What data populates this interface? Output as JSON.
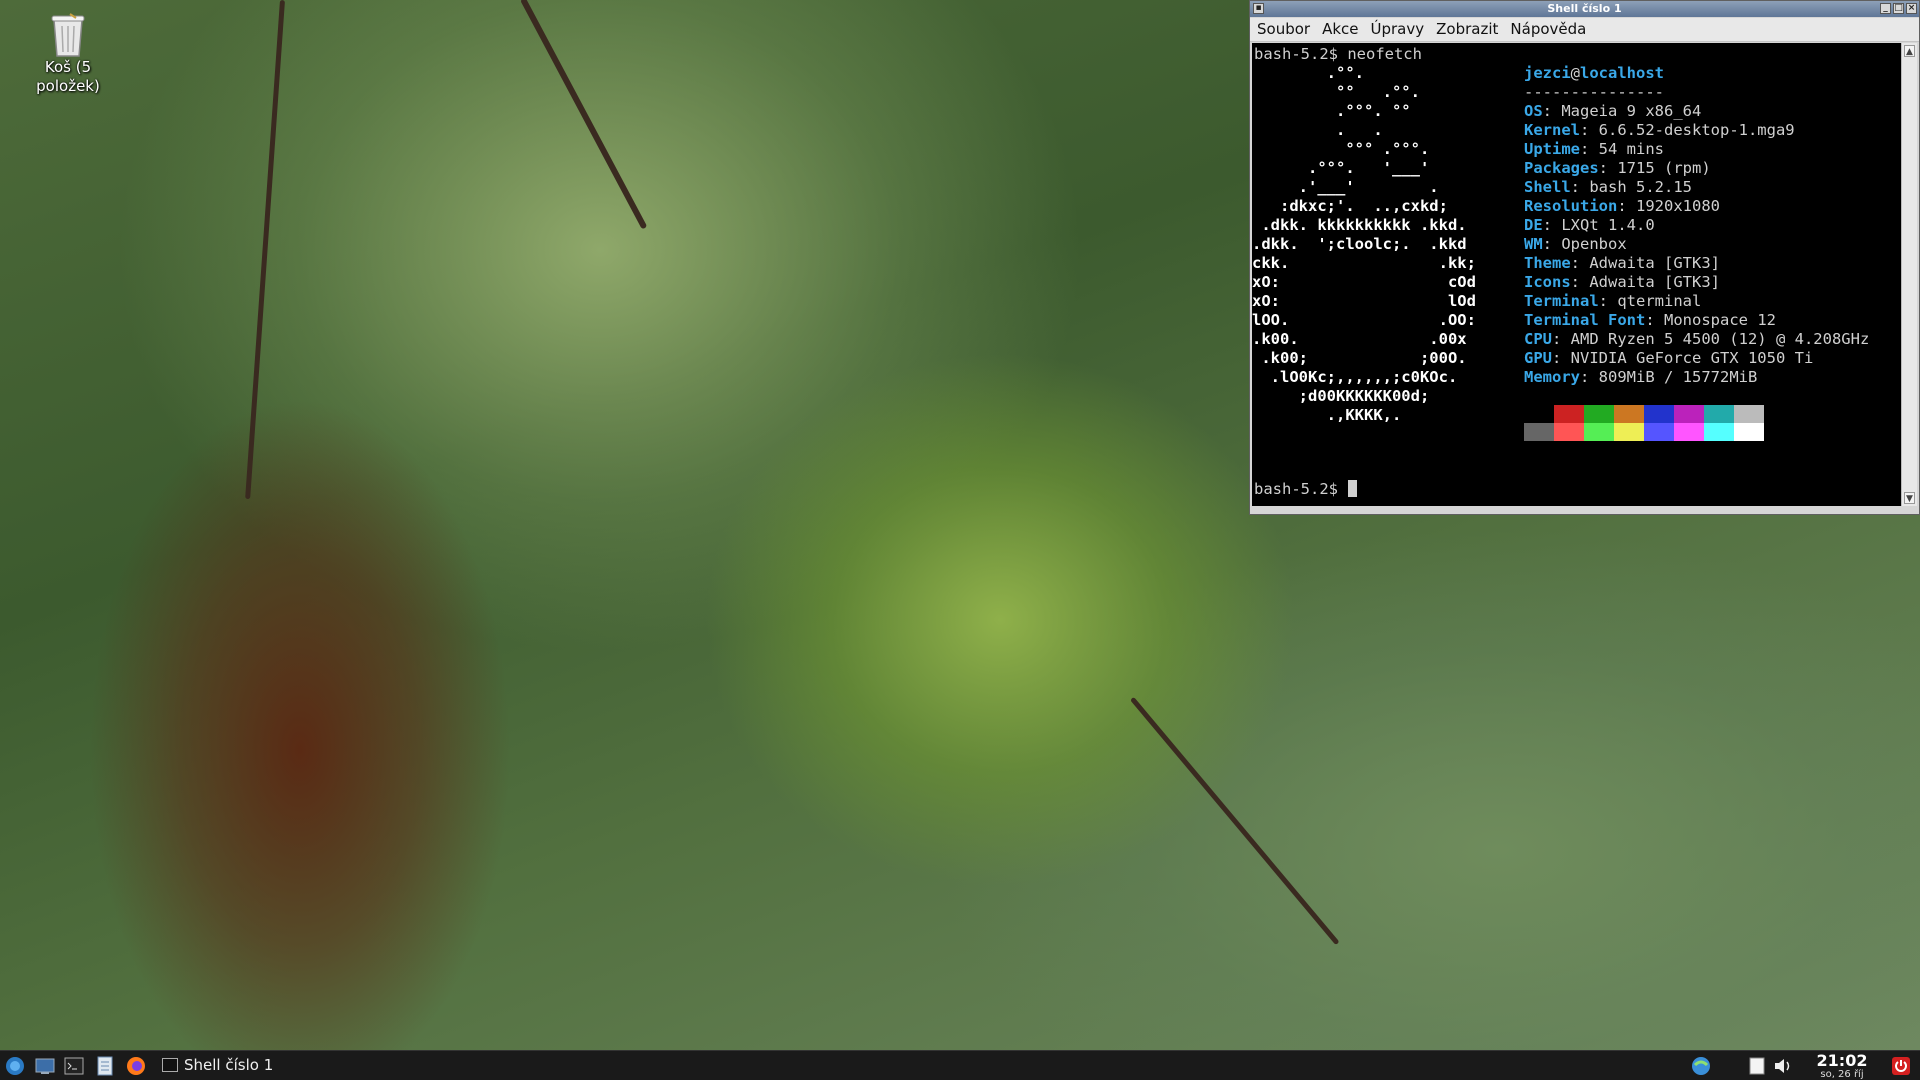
{
  "desktop": {
    "trash_label": "Koš (5 položek)"
  },
  "window": {
    "title": "Shell číslo 1",
    "menu": [
      "Soubor",
      "Akce",
      "Úpravy",
      "Zobrazit",
      "Nápověda"
    ]
  },
  "terminal": {
    "prompt_cmd": "bash-5.2$ neofetch",
    "ascii": [
      "        .°°.",
      "         °°   .°°.",
      "         .°°°. °°",
      "         .   .",
      "          °°° .°°°.",
      "      .°°°.   '___'",
      "     .'___'        .",
      "   :dkxc;'.  ..,cxkd;",
      " .dkk. kkkkkkkkkk .kkd.",
      ".dkk.  ';cloolc;.  .kkd",
      "ckk.                .kk;",
      "xO:                  cOd",
      "xO:                  lOd",
      "lOO.                .OO:",
      ".k00.              .00x",
      " .k00;            ;00O.",
      "  .lO0Kc;,,,,,,;c0KOc.",
      "     ;d00KKKKKK00d;",
      "        .,KKKK,."
    ],
    "user": "jezci",
    "at": "@",
    "host": "localhost",
    "separator": "---------------",
    "info": [
      {
        "key": "OS",
        "value": "Mageia 9 x86_64"
      },
      {
        "key": "Kernel",
        "value": "6.6.52-desktop-1.mga9"
      },
      {
        "key": "Uptime",
        "value": "54 mins"
      },
      {
        "key": "Packages",
        "value": "1715 (rpm)"
      },
      {
        "key": "Shell",
        "value": "bash 5.2.15"
      },
      {
        "key": "Resolution",
        "value": "1920x1080"
      },
      {
        "key": "DE",
        "value": "LXQt 1.4.0"
      },
      {
        "key": "WM",
        "value": "Openbox"
      },
      {
        "key": "Theme",
        "value": "Adwaita [GTK3]"
      },
      {
        "key": "Icons",
        "value": "Adwaita [GTK3]"
      },
      {
        "key": "Terminal",
        "value": "qterminal"
      },
      {
        "key": "Terminal Font",
        "value": "Monospace 12"
      },
      {
        "key": "CPU",
        "value": "AMD Ryzen 5 4500 (12) @ 4.208GHz"
      },
      {
        "key": "GPU",
        "value": "NVIDIA GeForce GTX 1050 Ti"
      },
      {
        "key": "Memory",
        "value": "809MiB / 15772MiB"
      }
    ],
    "palette_top": [
      "#000000",
      "#cc2222",
      "#22aa22",
      "#cc7722",
      "#2233cc",
      "#bb22bb",
      "#22aaaa",
      "#bbbbbb"
    ],
    "palette_bottom": [
      "#666666",
      "#ff5555",
      "#55ee55",
      "#eeee55",
      "#5555ff",
      "#ff55ff",
      "#55ffff",
      "#ffffff"
    ],
    "prompt2": "bash-5.2$ "
  },
  "taskbar": {
    "task_label": "Shell číslo 1",
    "time": "21:02",
    "date": "so, 26 říj"
  }
}
